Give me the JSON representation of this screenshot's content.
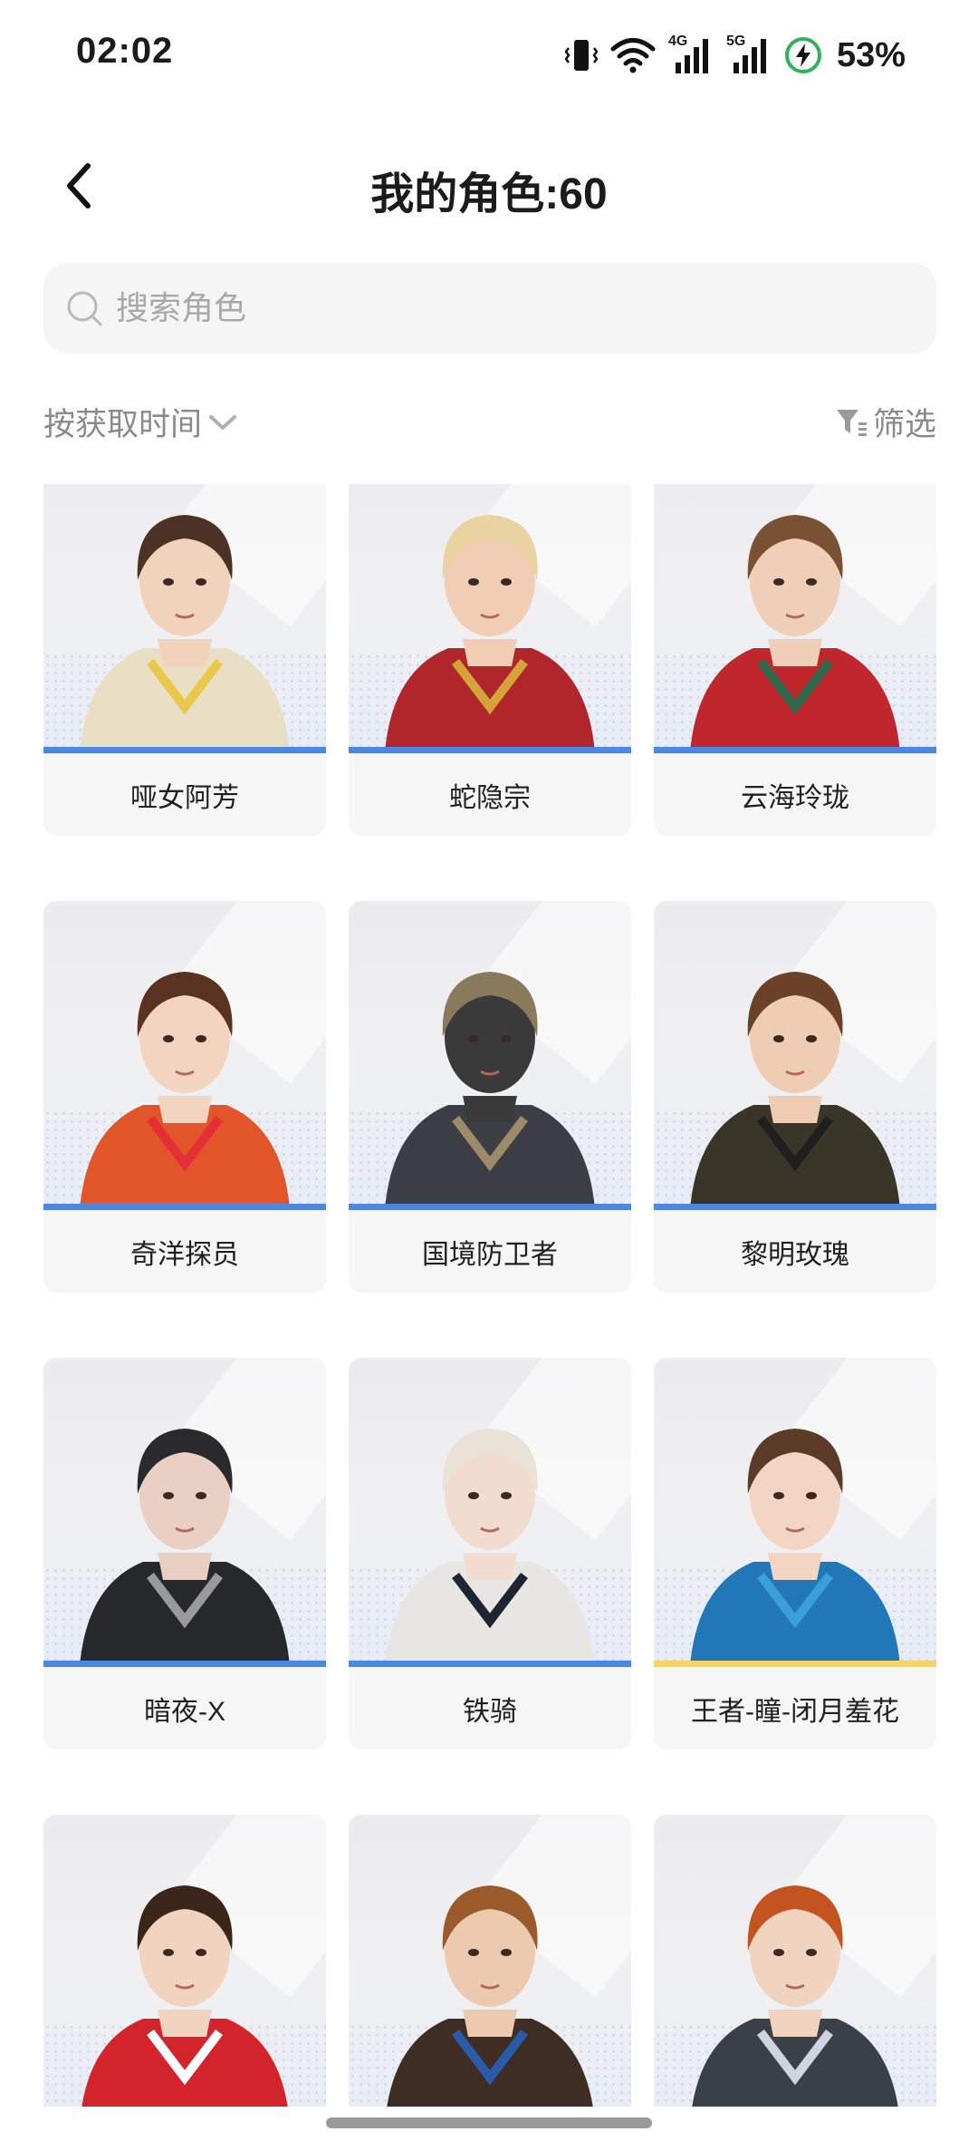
{
  "status_bar": {
    "time": "02:02",
    "network_1": "4G",
    "network_2": "5G",
    "battery": "53%"
  },
  "header": {
    "title": "我的角色:60",
    "back_icon": "chevron-left-icon"
  },
  "search": {
    "placeholder": "搜索角色",
    "value": ""
  },
  "toolbar": {
    "sort_label": "按获取时间",
    "filter_label": "筛选"
  },
  "characters": [
    {
      "name": "哑女阿芳",
      "rarity_color": "#4e86e4",
      "skin": "#f1d2bb",
      "hair": "#4a3325",
      "outfit": "#e9dfc4",
      "accent": "#e8c94a"
    },
    {
      "name": "蛇隐宗",
      "rarity_color": "#4e86e4",
      "skin": "#f0cdb4",
      "hair": "#e9d3a0",
      "outfit": "#b1262b",
      "accent": "#d6a33b"
    },
    {
      "name": "云海玲珑",
      "rarity_color": "#4e86e4",
      "skin": "#f0cfb8",
      "hair": "#7a5233",
      "outfit": "#c0272d",
      "accent": "#2f6a4f"
    },
    {
      "name": "奇洋探员",
      "rarity_color": "#4e86e4",
      "skin": "#f3d4c0",
      "hair": "#5a3222",
      "outfit": "#e2552b",
      "accent": "#e42f35"
    },
    {
      "name": "国境防卫者",
      "rarity_color": "#4e86e4",
      "skin": "#3a3a3a",
      "hair": "#8a7a5c",
      "outfit": "#3b3e44",
      "accent": "#9c8a6a"
    },
    {
      "name": "黎明玫瑰",
      "rarity_color": "#4e86e4",
      "skin": "#efcdb5",
      "hair": "#6b4128",
      "outfit": "#3a3627",
      "accent": "#1f1f1f"
    },
    {
      "name": "暗夜-X",
      "rarity_color": "#4e86e4",
      "skin": "#e9d0c2",
      "hair": "#2a2a2c",
      "outfit": "#26282c",
      "accent": "#9a9a9a"
    },
    {
      "name": "铁骑",
      "rarity_color": "#4e86e4",
      "skin": "#f2dccf",
      "hair": "#e9e3d7",
      "outfit": "#e8e6e2",
      "accent": "#1f2433"
    },
    {
      "name": "王者-瞳-闭月羞花",
      "rarity_color": "#f3d36a",
      "skin": "#f2d6c3",
      "hair": "#5b3a27",
      "outfit": "#2277b8",
      "accent": "#3aa0d8"
    },
    {
      "name": "",
      "rarity_color": "#4e86e4",
      "skin": "#f2d3c0",
      "hair": "#3a2519",
      "outfit": "#d2242a",
      "accent": "#ffffff"
    },
    {
      "name": "",
      "rarity_color": "#4e86e4",
      "skin": "#eccab0",
      "hair": "#9a5a2a",
      "outfit": "#3d2d22",
      "accent": "#2a5aa8"
    },
    {
      "name": "",
      "rarity_color": "#4e86e4",
      "skin": "#f0d4c0",
      "hair": "#c4541f",
      "outfit": "#3a4048",
      "accent": "#cfd5dc"
    }
  ]
}
